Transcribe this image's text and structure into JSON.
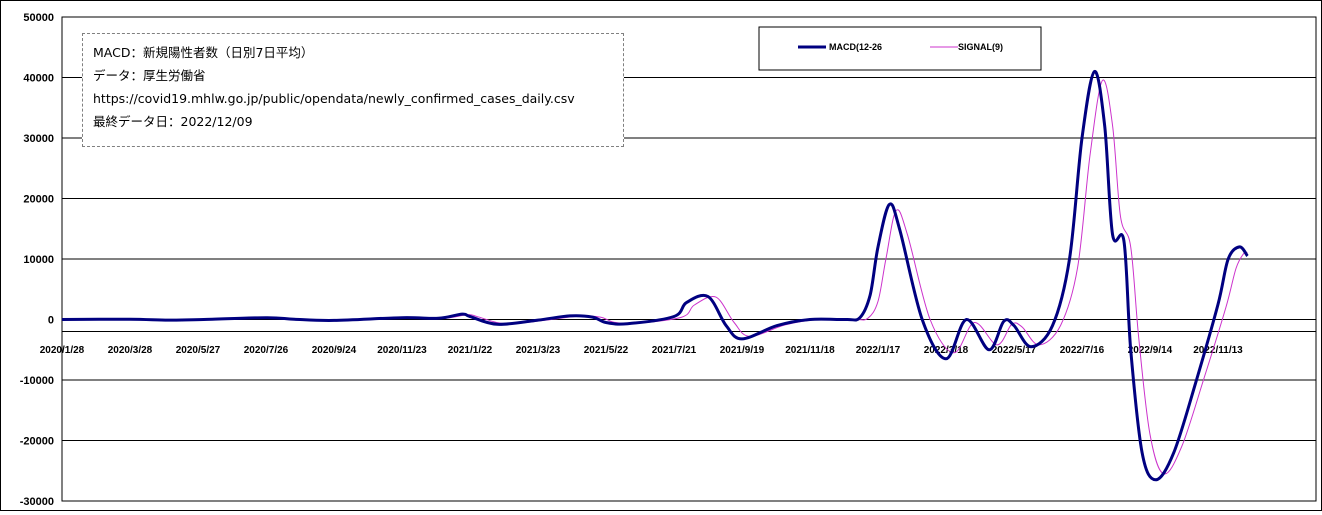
{
  "chart_data": {
    "type": "line",
    "annotation": [
      "MACD：新規陽性者数（日別7日平均）",
      "データ：厚生労働省",
      "https://covid19.mhlw.go.jp/public/opendata/newly_confirmed_cases_daily.csv",
      "最終データ日：2022/12/09"
    ],
    "y_ticks": [
      "50000",
      "40000",
      "30000",
      "20000",
      "10000",
      "0",
      "-10000",
      "-20000",
      "-30000"
    ],
    "ylim": [
      -30000,
      50000
    ],
    "grid": "horizontal",
    "x_tick_labels": [
      "2020/1/28",
      "2020/3/28",
      "2020/5/27",
      "2020/7/26",
      "2020/9/24",
      "2020/11/23",
      "2021/1/22",
      "2021/3/23",
      "2021/5/22",
      "2021/7/21",
      "2021/9/19",
      "2021/11/18",
      "2022/1/17",
      "2022/3/18",
      "2022/5/17",
      "2022/7/16",
      "2022/9/14",
      "2022/11/13"
    ],
    "xlim": [
      "2020/1/28",
      "2022/12/09"
    ],
    "legend_position": "top-center",
    "series": [
      {
        "name": "MACD(12-26",
        "color": "#000080",
        "points": [
          [
            "2020/1/28",
            0
          ],
          [
            "2020/3/28",
            50
          ],
          [
            "2020/5/1",
            -100
          ],
          [
            "2020/6/1",
            0
          ],
          [
            "2020/7/26",
            300
          ],
          [
            "2020/8/20",
            50
          ],
          [
            "2020/9/24",
            -150
          ],
          [
            "2020/11/23",
            300
          ],
          [
            "2020/12/25",
            200
          ],
          [
            "2021/1/15",
            900
          ],
          [
            "2021/1/22",
            500
          ],
          [
            "2021/2/15",
            -800
          ],
          [
            "2021/3/23",
            -100
          ],
          [
            "2021/4/20",
            600
          ],
          [
            "2021/5/10",
            400
          ],
          [
            "2021/5/22",
            -500
          ],
          [
            "2021/6/10",
            -700
          ],
          [
            "2021/7/21",
            500
          ],
          [
            "2021/8/1",
            2800
          ],
          [
            "2021/8/20",
            3800
          ],
          [
            "2021/9/5",
            -1000
          ],
          [
            "2021/9/19",
            -3200
          ],
          [
            "2021/10/20",
            -1000
          ],
          [
            "2021/11/18",
            0
          ],
          [
            "2021/12/20",
            0
          ],
          [
            "2022/1/1",
            300
          ],
          [
            "2022/1/10",
            4000
          ],
          [
            "2022/1/17",
            12000
          ],
          [
            "2022/1/27",
            19000
          ],
          [
            "2022/2/5",
            15000
          ],
          [
            "2022/2/25",
            0
          ],
          [
            "2022/3/18",
            -6500
          ],
          [
            "2022/4/5",
            0
          ],
          [
            "2022/4/25",
            -5000
          ],
          [
            "2022/5/8",
            -300
          ],
          [
            "2022/5/17",
            -1000
          ],
          [
            "2022/6/1",
            -4500
          ],
          [
            "2022/6/20",
            -1000
          ],
          [
            "2022/7/5",
            10000
          ],
          [
            "2022/7/16",
            30000
          ],
          [
            "2022/7/27",
            41000
          ],
          [
            "2022/8/5",
            32000
          ],
          [
            "2022/8/12",
            14000
          ],
          [
            "2022/8/22",
            13000
          ],
          [
            "2022/8/28",
            -5000
          ],
          [
            "2022/9/7",
            -22000
          ],
          [
            "2022/9/19",
            -26500
          ],
          [
            "2022/10/5",
            -22000
          ],
          [
            "2022/10/25",
            -10000
          ],
          [
            "2022/11/13",
            2500
          ],
          [
            "2022/11/22",
            10000
          ],
          [
            "2022/12/2",
            12000
          ],
          [
            "2022/12/09",
            10500
          ]
        ]
      },
      {
        "name": "SIGNAL(9)",
        "color": "#cc33cc",
        "points": [
          [
            "2020/1/28",
            0
          ],
          [
            "2020/3/28",
            40
          ],
          [
            "2020/5/5",
            -80
          ],
          [
            "2020/6/5",
            0
          ],
          [
            "2020/8/1",
            250
          ],
          [
            "2020/8/25",
            40
          ],
          [
            "2020/10/1",
            -100
          ],
          [
            "2020/11/28",
            280
          ],
          [
            "2020/12/30",
            200
          ],
          [
            "2021/1/20",
            800
          ],
          [
            "2021/1/29",
            450
          ],
          [
            "2021/2/22",
            -700
          ],
          [
            "2021/3/30",
            -100
          ],
          [
            "2021/4/27",
            550
          ],
          [
            "2021/5/17",
            400
          ],
          [
            "2021/5/29",
            -450
          ],
          [
            "2021/6/17",
            -650
          ],
          [
            "2021/7/28",
            400
          ],
          [
            "2021/8/8",
            2400
          ],
          [
            "2021/8/27",
            3700
          ],
          [
            "2021/9/12",
            -500
          ],
          [
            "2021/9/26",
            -2800
          ],
          [
            "2021/10/27",
            -900
          ],
          [
            "2021/11/25",
            0
          ],
          [
            "2021/12/27",
            0
          ],
          [
            "2022/1/8",
            200
          ],
          [
            "2022/1/17",
            3000
          ],
          [
            "2022/1/24",
            10000
          ],
          [
            "2022/2/2",
            18000
          ],
          [
            "2022/2/12",
            14000
          ],
          [
            "2022/3/4",
            0
          ],
          [
            "2022/3/25",
            -5500
          ],
          [
            "2022/4/12",
            -500
          ],
          [
            "2022/5/2",
            -4200
          ],
          [
            "2022/5/15",
            -800
          ],
          [
            "2022/5/24",
            -1200
          ],
          [
            "2022/6/8",
            -4200
          ],
          [
            "2022/6/27",
            -1000
          ],
          [
            "2022/7/12",
            8500
          ],
          [
            "2022/7/23",
            27000
          ],
          [
            "2022/8/3",
            39500
          ],
          [
            "2022/8/12",
            32000
          ],
          [
            "2022/8/19",
            17000
          ],
          [
            "2022/8/28",
            12000
          ],
          [
            "2022/9/4",
            -3000
          ],
          [
            "2022/9/14",
            -19000
          ],
          [
            "2022/9/26",
            -25500
          ],
          [
            "2022/10/12",
            -21000
          ],
          [
            "2022/11/1",
            -9500
          ],
          [
            "2022/11/20",
            2000
          ],
          [
            "2022/11/29",
            8500
          ],
          [
            "2022/12/6",
            11000
          ],
          [
            "2022/12/09",
            11000
          ]
        ]
      }
    ]
  }
}
